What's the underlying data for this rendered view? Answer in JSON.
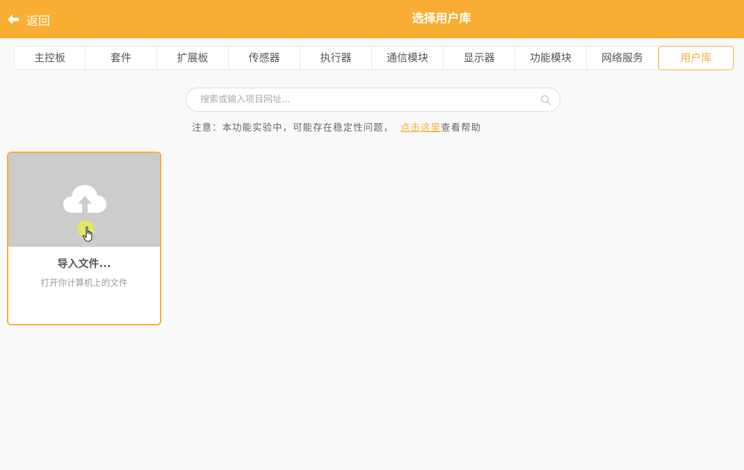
{
  "header": {
    "back_label": "返回",
    "title": "选择用户库",
    "bg_color": "#f9ae33"
  },
  "tabs": [
    {
      "label": "主控板",
      "active": false
    },
    {
      "label": "套件",
      "active": false
    },
    {
      "label": "扩展板",
      "active": false
    },
    {
      "label": "传感器",
      "active": false
    },
    {
      "label": "执行器",
      "active": false
    },
    {
      "label": "通信模块",
      "active": false
    },
    {
      "label": "显示器",
      "active": false
    },
    {
      "label": "功能模块",
      "active": false
    },
    {
      "label": "网络服务",
      "active": false
    },
    {
      "label": "用户库",
      "active": true
    }
  ],
  "search": {
    "placeholder": "搜索或输入项目网址...",
    "value": "",
    "icon": "search-icon"
  },
  "notice": {
    "text": "注意：本功能实验中，可能存在稳定性问题，",
    "link_text": "点击这里",
    "suffix": "查看帮助"
  },
  "import_card": {
    "title": "导入文件...",
    "description": "打开你计算机上的文件",
    "icon": "cloud-upload-icon"
  },
  "colors": {
    "accent": "#f9ae33",
    "background": "#f9f9f9",
    "card_top": "#cccccc"
  }
}
